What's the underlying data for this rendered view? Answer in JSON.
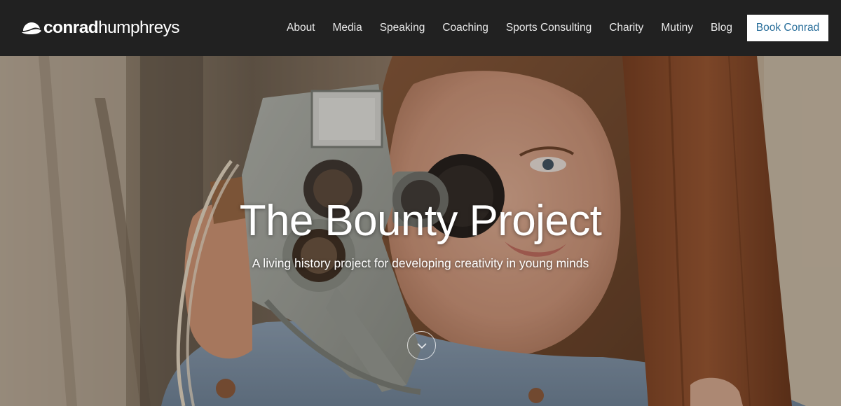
{
  "header": {
    "logo": {
      "first": "conrad",
      "last": "humphreys",
      "icon": "hat-icon"
    },
    "nav": [
      {
        "label": "About"
      },
      {
        "label": "Media"
      },
      {
        "label": "Speaking"
      },
      {
        "label": "Coaching"
      },
      {
        "label": "Sports Consulting"
      },
      {
        "label": "Charity"
      },
      {
        "label": "Mutiny"
      },
      {
        "label": "Blog"
      }
    ],
    "cta": {
      "label": "Book Conrad"
    }
  },
  "hero": {
    "title": "The Bounty Project",
    "subtitle": "A living history project for developing creativity in young minds",
    "scroll_icon": "chevron-down-icon"
  },
  "colors": {
    "header_bg": "#212121",
    "cta_text": "#2a6f9b",
    "cta_bg": "#ffffff"
  }
}
